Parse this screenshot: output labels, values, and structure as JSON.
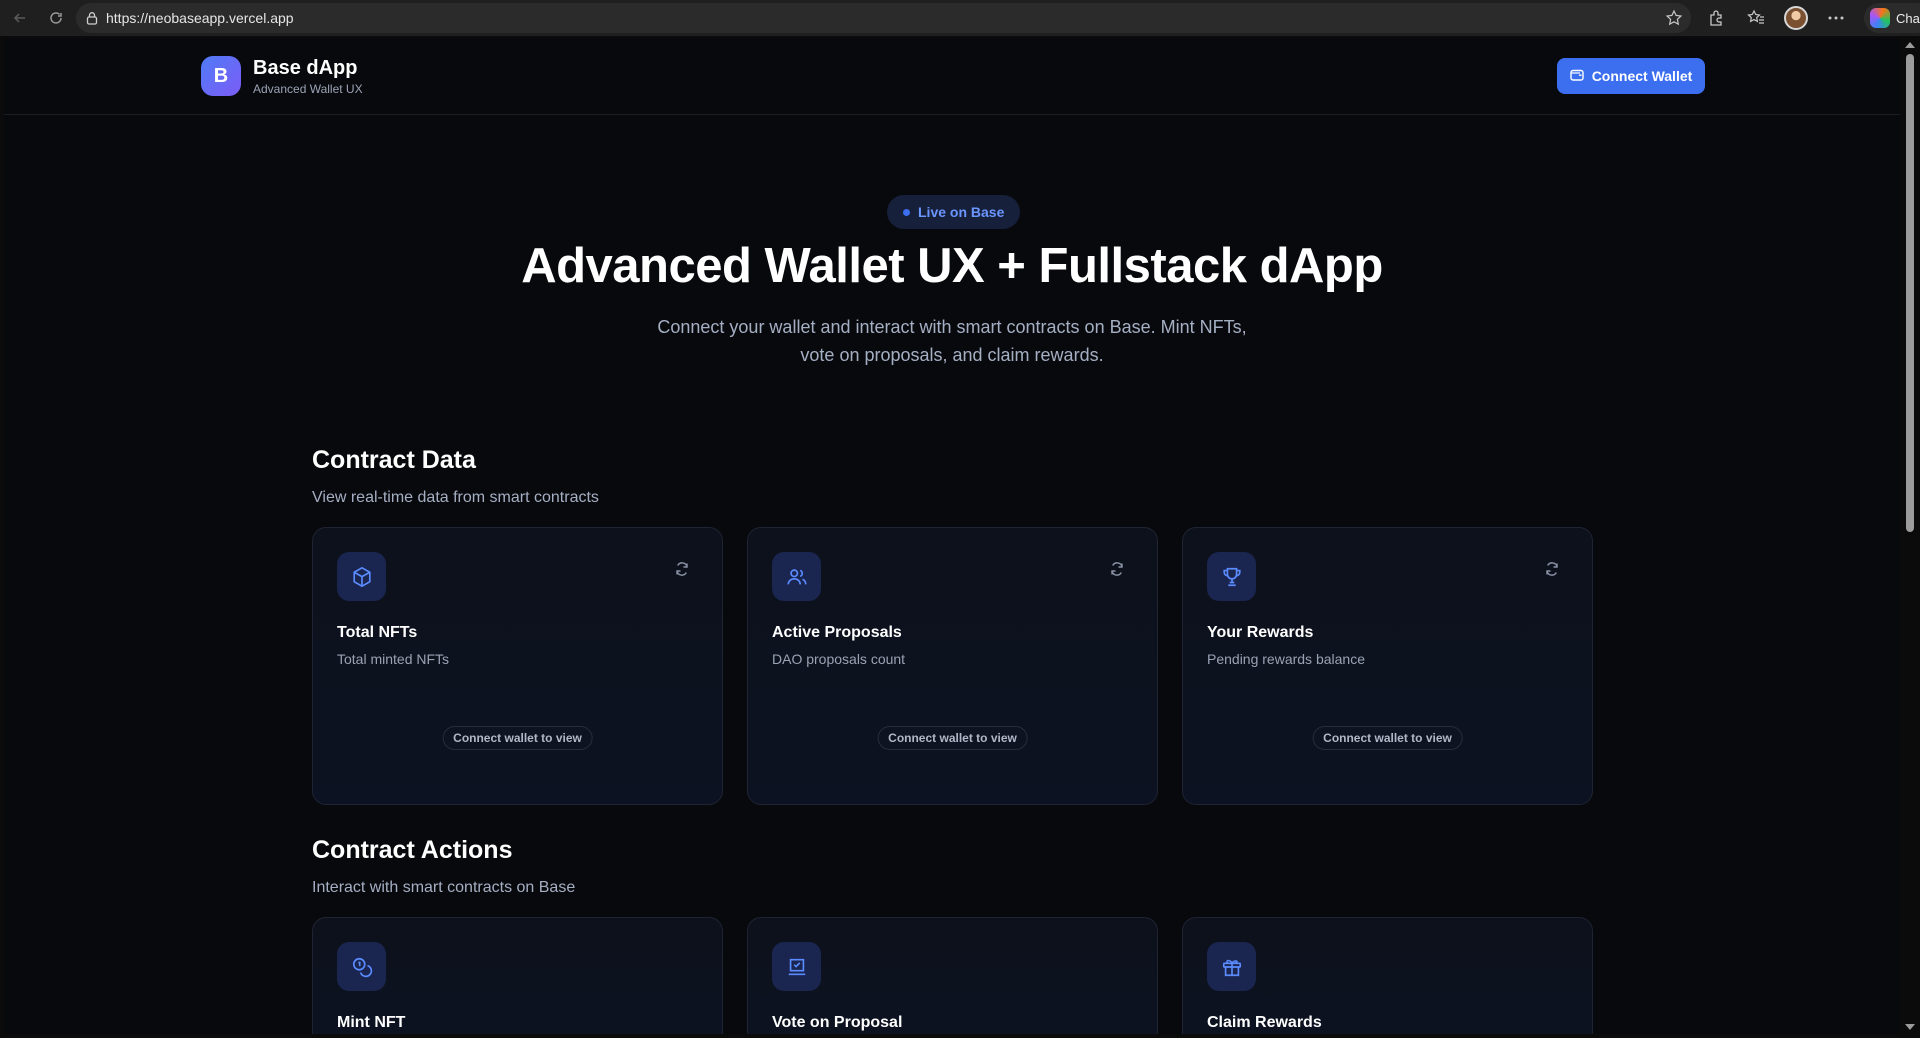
{
  "browser": {
    "url": "https://neobaseapp.vercel.app",
    "chat_label": "Chat"
  },
  "header": {
    "logo_letter": "B",
    "app_name": "Base dApp",
    "app_subtitle": "Advanced Wallet UX",
    "connect_label": "Connect Wallet"
  },
  "hero": {
    "badge": "Live on Base",
    "title": "Advanced Wallet UX + Fullstack dApp",
    "subtitle_line1": "Connect your wallet and interact with smart contracts on Base. Mint NFTs,",
    "subtitle_line2": "vote on proposals, and claim rewards."
  },
  "contract_data": {
    "title": "Contract Data",
    "subtitle": "View real-time data from smart contracts",
    "cards": [
      {
        "icon": "cube-icon",
        "title": "Total NFTs",
        "desc": "Total minted NFTs",
        "status": "Connect wallet to view"
      },
      {
        "icon": "users-icon",
        "title": "Active Proposals",
        "desc": "DAO proposals count",
        "status": "Connect wallet to view"
      },
      {
        "icon": "trophy-icon",
        "title": "Your Rewards",
        "desc": "Pending rewards balance",
        "status": "Connect wallet to view"
      }
    ]
  },
  "contract_actions": {
    "title": "Contract Actions",
    "subtitle": "Interact with smart contracts on Base",
    "cards": [
      {
        "icon": "coins-icon",
        "title": "Mint NFT"
      },
      {
        "icon": "vote-icon",
        "title": "Vote on Proposal"
      },
      {
        "icon": "gift-icon",
        "title": "Claim Rewards"
      }
    ]
  },
  "colors": {
    "accent": "#3b6ff0",
    "background": "#08090c",
    "card_bg": "#0d111b",
    "icon_bg": "#1a2550",
    "icon_fg": "#5b8cff"
  }
}
